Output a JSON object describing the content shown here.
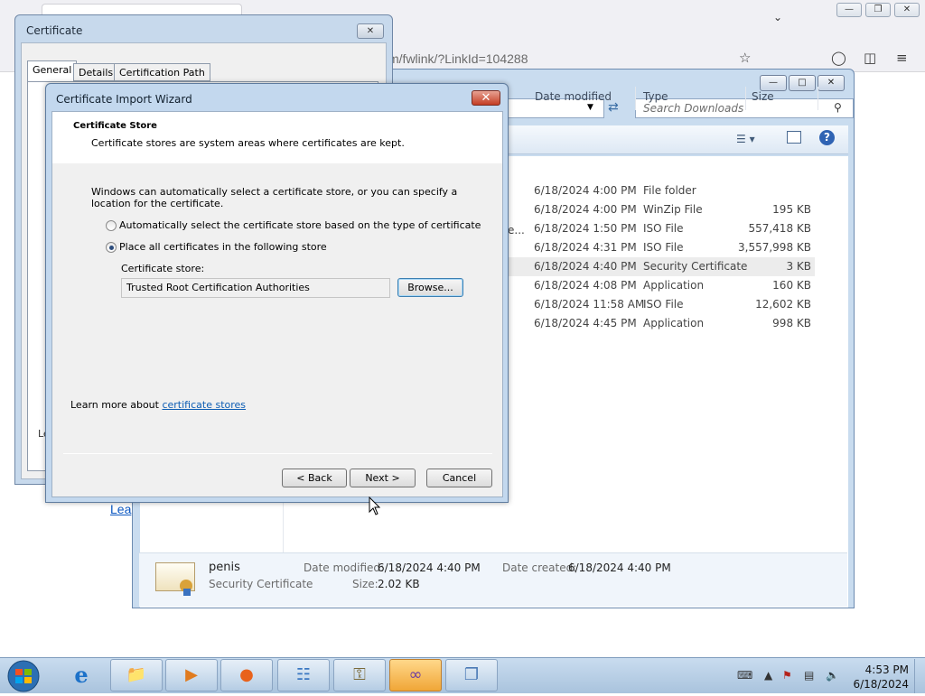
{
  "browser": {
    "url_fragment": "m/fwlink/?LinkId=104288",
    "link_text": "Lea"
  },
  "explorer": {
    "search_placeholder": "Search Downloads",
    "columns": [
      "Date modified",
      "Type",
      "Size"
    ],
    "truncated_name_fragment": "e...",
    "rows": [
      {
        "date": "6/18/2024 4:00 PM",
        "type": "File folder",
        "size": ""
      },
      {
        "date": "6/18/2024 4:00 PM",
        "type": "WinZip File",
        "size": "195 KB"
      },
      {
        "date": "6/18/2024 1:50 PM",
        "type": "ISO File",
        "size": "557,418 KB"
      },
      {
        "date": "6/18/2024 4:31 PM",
        "type": "ISO File",
        "size": "3,557,998 KB"
      },
      {
        "date": "6/18/2024 4:40 PM",
        "type": "Security Certificate",
        "size": "3 KB"
      },
      {
        "date": "6/18/2024 4:08 PM",
        "type": "Application",
        "size": "160 KB"
      },
      {
        "date": "6/18/2024 11:58 AM",
        "type": "ISO File",
        "size": "12,602 KB"
      },
      {
        "date": "6/18/2024 4:45 PM",
        "type": "Application",
        "size": "998 KB"
      }
    ],
    "details": {
      "name": "penis",
      "type": "Security Certificate",
      "modified_label": "Date modified:",
      "modified_value": "6/18/2024 4:40 PM",
      "created_label": "Date created:",
      "created_value": "6/18/2024 4:40 PM",
      "size_label": "Size:",
      "size_value": "2.02 KB"
    }
  },
  "certificate": {
    "title": "Certificate",
    "tabs": [
      "General",
      "Details",
      "Certification Path"
    ],
    "hidden_text_fragment": "Le"
  },
  "wizard": {
    "title": "Certificate Import Wizard",
    "header_title": "Certificate Store",
    "header_subtitle": "Certificate stores are system areas where certificates are kept.",
    "intro": "Windows can automatically select a certificate store, or you can specify a location for the certificate.",
    "option_auto": "Automatically select the certificate store based on the type of certificate",
    "option_place": "Place all certificates in the following store",
    "store_label": "Certificate store:",
    "store_value": "Trusted Root Certification Authorities",
    "browse_label": "Browse...",
    "learn_more_prefix": "Learn more about ",
    "learn_more_link": "certificate stores",
    "back_label": "< Back",
    "next_label": "Next >",
    "cancel_label": "Cancel",
    "selected_option": "place"
  },
  "taskbar": {
    "time": "4:53 PM",
    "date": "6/18/2024",
    "items": [
      "ie-icon",
      "explorer-icon",
      "media-player-icon",
      "firefox-icon",
      "control-panel-icon",
      "certificate-tool-icon",
      "visual-studio-icon",
      "notepad-icon"
    ]
  }
}
